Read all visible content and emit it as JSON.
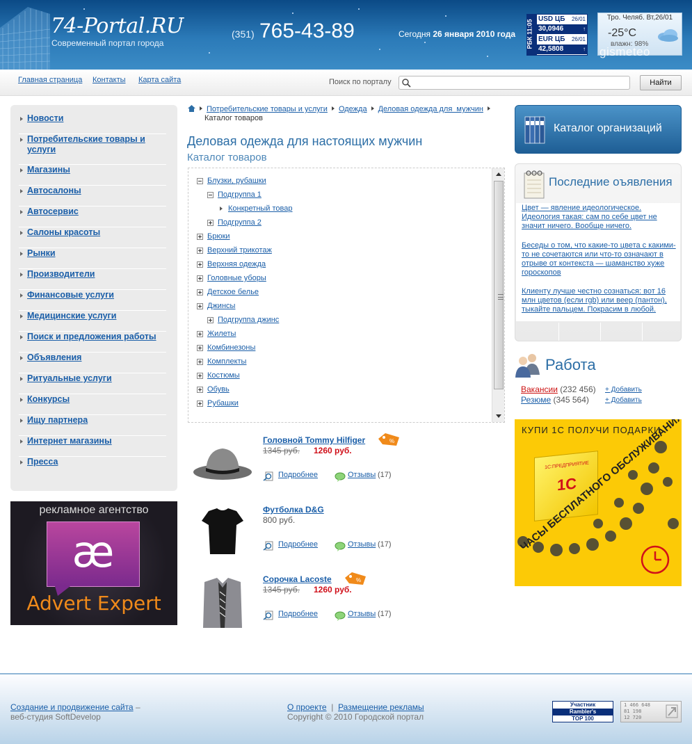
{
  "header": {
    "logo_title": "74-Portal.RU",
    "logo_subtitle": "Современный портал города",
    "phone_code": "(351)",
    "phone_number": "765-43-89",
    "date_prefix": "Сегодня",
    "date_value": "26 января 2010 года",
    "rbc": {
      "side": "РБК 11:05",
      "rows": [
        {
          "label": "USD ЦБ",
          "date": "26/01"
        },
        {
          "label": "30,0946",
          "date": "↑"
        },
        {
          "label": "EUR ЦБ",
          "date": "26/01"
        },
        {
          "label": "42,5808",
          "date": "↑"
        }
      ]
    },
    "weather": {
      "head": "Тро. Челяб. Вт,26/01",
      "temp": "-25°C",
      "humidity": "влажн: 98%",
      "brand": "gismeteo"
    }
  },
  "nav": {
    "links": [
      "Главная страница",
      "Контакты",
      "Карта сайта"
    ],
    "search_label": "Поиск по порталу",
    "search_placeholder": "",
    "search_button": "Найти"
  },
  "sidebar": {
    "items": [
      "Новости",
      "Потребительские товары и услуги",
      "Магазины",
      "Автосалоны",
      "Автосервис",
      "Салоны красоты",
      "Рынки",
      "Производители",
      "Финансовые услуги",
      "Медицинские услуги",
      "Поиск и предложения работы",
      "Объявления",
      "Ритуальные услуги",
      "Конкурсы",
      "Ищу партнера",
      "Интернет магазины",
      "Пресса"
    ],
    "ad": {
      "top": "рекламное агентство",
      "mark": "æ",
      "name": "Advert Expert"
    }
  },
  "breadcrumb": [
    "Потребительские товары и услуги",
    "Одежда",
    "Деловая одежда для  мужчин",
    "Каталог товаров"
  ],
  "main": {
    "title": "Деловая одежда для настоящих мужчин",
    "subtitle": "Каталог товаров"
  },
  "tree": [
    {
      "label": "Блузки, рубашки",
      "level": 0,
      "icon": "minus"
    },
    {
      "label": "Подгруппа 1",
      "level": 1,
      "icon": "minus"
    },
    {
      "label": "Конкретный товар",
      "level": 2,
      "icon": "arrow"
    },
    {
      "label": "Подгруппа 2",
      "level": 1,
      "icon": "plus"
    },
    {
      "label": "Брюки",
      "level": 0,
      "icon": "plus"
    },
    {
      "label": "Верхний трикотаж",
      "level": 0,
      "icon": "plus"
    },
    {
      "label": "Верхняя одежда",
      "level": 0,
      "icon": "plus"
    },
    {
      "label": "Головные уборы",
      "level": 0,
      "icon": "plus"
    },
    {
      "label": "Детское белье",
      "level": 0,
      "icon": "plus"
    },
    {
      "label": "Джинсы",
      "level": 0,
      "icon": "plus"
    },
    {
      "label": "Подгруппа джинс",
      "level": 1,
      "icon": "plus"
    },
    {
      "label": "Жилеты",
      "level": 0,
      "icon": "plus"
    },
    {
      "label": "Комбинезоны",
      "level": 0,
      "icon": "plus"
    },
    {
      "label": "Комплекты",
      "level": 0,
      "icon": "plus"
    },
    {
      "label": "Костюмы",
      "level": 0,
      "icon": "plus"
    },
    {
      "label": "Обувь",
      "level": 0,
      "icon": "plus"
    },
    {
      "label": "Рубашки",
      "level": 0,
      "icon": "plus"
    }
  ],
  "products": [
    {
      "title": "Головной Tommy Hilfiger",
      "old_price": "1345 руб.",
      "new_price": "1260 руб.",
      "price": "",
      "sale": true,
      "more": "Подробнее",
      "reviews": "Отзывы",
      "count": "(17)",
      "image": "hat"
    },
    {
      "title": "Футболка D&G",
      "old_price": "",
      "new_price": "",
      "price": "800 руб.",
      "sale": false,
      "more": "Подробнее",
      "reviews": "Отзывы",
      "count": "(17)",
      "image": "tshirt"
    },
    {
      "title": "Сорочка Lacoste",
      "old_price": "1345 руб.",
      "new_price": "1260 руб.",
      "price": "",
      "sale": true,
      "more": "Подробнее",
      "reviews": "Отзывы",
      "count": "(17)",
      "image": "shirt"
    }
  ],
  "right": {
    "catalog_label": "Каталог организаций",
    "ads_title": "Последние оъявления",
    "ads": [
      "Цвет — явление идеологическое. Идеология такая: сам по себе цвет не значит ничего. Вообще ничего.",
      "Беседы о том, что какие-то цвета с какими-то не сочетаются или что-то означают в отрыве от контекста — шаманство хуже гороскопов",
      "Клиенту лучше честно сознаться: вот 16 млн цветов (если rgb) или веер (пантон), тыкайте пальцем. Покрасим в любой."
    ],
    "work_title": "Работа",
    "work": [
      {
        "label": "Вакансии",
        "count": "(232 456)",
        "add": "+ Добавить"
      },
      {
        "label": "Резюме",
        "count": "(345 564)",
        "add": "+ Добавить"
      }
    ],
    "ad1c": {
      "top": "КУПИ 1С ПОЛУЧИ ПОДАРКИ",
      "bottom": "ЧАСЫ БЕСПЛАТНОГО ОБСЛУЖИВАНИЯ",
      "logo": "1С",
      "box_text": "1С:ПРЕДПРИЯТИЕ"
    }
  },
  "footer": {
    "link1": "Создание и продвижение сайта",
    "dash": " –",
    "studio": "веб-студия SoftDevelop",
    "about": "О проекте",
    "sep": "|",
    "ads_link": "Размещение рекламы",
    "copyright": "Copyright © 2010 Городской портал",
    "rambler": [
      "Участник",
      "Rambler's",
      "TOP 100"
    ],
    "counter": [
      "1 466 648",
      "81 198",
      "12 720"
    ]
  },
  "colors": {
    "link": "#1a5ea8",
    "title": "#2c6ea6",
    "sale": "#d0101a",
    "header": "#2b7ab8"
  }
}
